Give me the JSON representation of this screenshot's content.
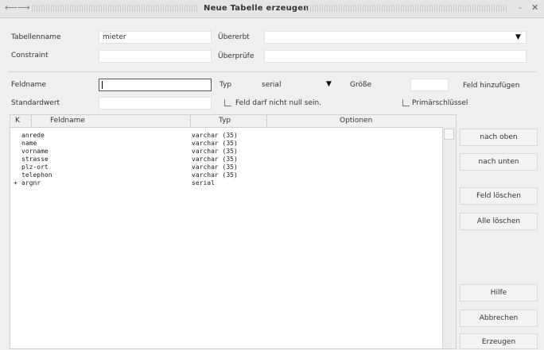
{
  "window": {
    "title": "Neue Tabelle erzeugen",
    "back_icon": "back-arrow-icon",
    "forward_icon": "forward-arrow-icon",
    "minimize_glyph": "-",
    "close_glyph": "✕"
  },
  "table_name": {
    "label": "Tabellenname",
    "value": "mieter"
  },
  "constraint": {
    "label": "Constraint",
    "value": ""
  },
  "inherits": {
    "label": "Übererbt",
    "value": ""
  },
  "check": {
    "label": "Überprüfe",
    "value": ""
  },
  "field_name": {
    "label": "Feldname",
    "value": ""
  },
  "type": {
    "label": "Typ",
    "value": "serial"
  },
  "size": {
    "label": "Größe",
    "value": ""
  },
  "add_field_button": "Feld hinzufügen",
  "default_value": {
    "label": "Standardwert",
    "value": ""
  },
  "not_null_checkbox": "Feld darf nicht null sein.",
  "primary_key_checkbox": "Primärschlüssel",
  "columns": {
    "key": "K",
    "name": "Feldname",
    "type": "Typ",
    "options": "Optionen"
  },
  "rows": [
    {
      "key": "",
      "name": "anrede",
      "type": "varchar (35)",
      "options": ""
    },
    {
      "key": "",
      "name": "name",
      "type": "varchar (35)",
      "options": ""
    },
    {
      "key": "",
      "name": "vorname",
      "type": "varchar (35)",
      "options": ""
    },
    {
      "key": "",
      "name": "strasse",
      "type": "varchar (35)",
      "options": ""
    },
    {
      "key": "",
      "name": "plz-ort",
      "type": "varchar (35)",
      "options": ""
    },
    {
      "key": "",
      "name": "telephon",
      "type": "varchar (35)",
      "options": ""
    },
    {
      "key": "+",
      "name": "argnr",
      "type": "serial",
      "options": ""
    }
  ],
  "buttons": {
    "up": "nach oben",
    "down": "nach unten",
    "delete_field": "Feld löschen",
    "delete_all": "Alle löschen",
    "help": "Hilfe",
    "cancel": "Abbrechen",
    "create": "Erzeugen"
  }
}
